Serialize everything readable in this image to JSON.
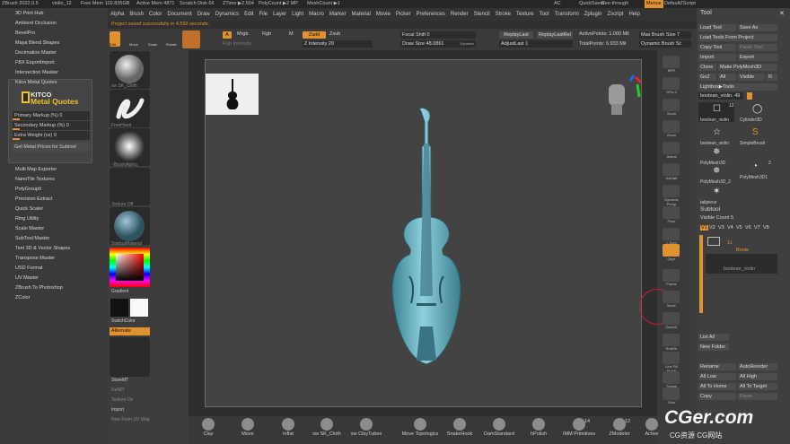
{
  "titlebar": {
    "app": "ZBrush 2022.0.5",
    "doc": "violin_12",
    "free_mem": "Free Mem 102.835GB",
    "active_mem": "Active Mem 4871",
    "scratch": "Scratch Disk 66",
    "ztime": "ZTime ▶2.504",
    "polycount": "PolyCount ▶2 MP",
    "meshcount": "MeshCount ▶1",
    "ac": "AC",
    "quicksave": "QuickSave",
    "seethrough": "See-through",
    "seethrough_val": "0",
    "menus": "Menus",
    "script": "DefaultZScript"
  },
  "menu": [
    "Alpha",
    "Brush",
    "Color",
    "Document",
    "Draw",
    "Dynamics",
    "Edit",
    "File",
    "Layer",
    "Light",
    "Macro",
    "Marker",
    "Material",
    "Movie",
    "Picker",
    "Preferences",
    "Render",
    "Stencil",
    "Stroke",
    "Texture",
    "Tool",
    "Transform",
    "Zplugin",
    "Zscript",
    "Help"
  ],
  "notification": "Project saved successfully in 4.592 seconds.",
  "left_plugins_top": [
    "3D Print Hub",
    "Ambient Occlusion",
    "BevelPro",
    "Maya Blend Shapes",
    "Decimation Master",
    "FBX ExportImport",
    "Intersection Masker",
    "Kitco Metal Quotes"
  ],
  "kitco": {
    "logo1": "KITCO",
    "logo2": "Metal Quotes",
    "primary": "Primary Markup (%) 0",
    "secondary": "Secondary Markup (%) 0",
    "extra": "Extra Weight (oz) 0",
    "button": "Get Metal Prices for Subtool"
  },
  "left_plugins_bottom": [
    "Multi Map Exporter",
    "NanoTile Textures",
    "PolyGroupIt",
    "Precision Extract",
    "Quick Scaler",
    "Ring Utility",
    "Scale Master",
    "SubTool Master",
    "Text 3D & Vector Shapes",
    "Transpose Master",
    "USD Format",
    "UV Master",
    "ZBrush To Photoshop",
    "ZColor"
  ],
  "shelf": {
    "brush": "sw SK_Cloth",
    "stroke": "FreeHand",
    "alpha": "~BrushAlpha",
    "texture": "Texture Off",
    "material": "StartupMaterial",
    "gradient": "Gradient",
    "switchcolor": "SwitchColor",
    "alternate": "Alternate",
    "store": "StoreMT",
    "delmt": "DelMT",
    "texon": "Texture On",
    "import": "Import",
    "newfromuv": "New From UV Map"
  },
  "topbar": {
    "edit": "Edit",
    "move": "Move",
    "scale": "Scale",
    "rotate": "Rotate",
    "a": "A",
    "mrgb": "Mrgb",
    "rgb": "Rgb",
    "m": "M",
    "zadd": "Zadd",
    "zsub": "Zsub",
    "rgb_intensity": "Rgb Intensity",
    "z_intensity": "Z Intensity 20",
    "focal_shift": "Focal Shift 0",
    "draw_size": "Draw Size 48.0861",
    "dynamic": "Dynamic",
    "replaylast": "ReplayLast",
    "replaylastrel": "ReplayLastRel",
    "adjustlast": "AdjustLast 1",
    "active_points": "ActivePoints: 1.000 Mil",
    "total_points": "TotalPoints: 6.933 Mil",
    "max_brush": "Max Brush Size 7",
    "dynamic_brush": "Dynamic Brush Sc"
  },
  "right_shelf": [
    "BPR",
    "SPix 3",
    "Scroll",
    "Zoom",
    "Actual",
    "AAHalf",
    "Dynamic Persp",
    "Floor",
    "L.Sym",
    "Qxyz",
    "Frame",
    "Move",
    "ZoomD",
    "RotaTe",
    "Line Fill PolyF",
    "Transp",
    "Solo"
  ],
  "tool_panel": {
    "title": "Tool",
    "load_tool": "Load Tool",
    "save_as": "Save As",
    "load_from_project": "Load Tools From Project",
    "copy_tool": "Copy Tool",
    "paste_tool": "Paste Tool",
    "import": "Import",
    "export": "Export",
    "clone": "Clone",
    "make_polymesh": "Make PolyMesh3D",
    "goz": "GoZ",
    "all": "All",
    "visible": "Visible",
    "r": "R",
    "lightbox": "Lightbox▶Tools",
    "current_tool": "boolean_violin. 49",
    "tools": [
      {
        "name": "boolean_violin",
        "count": "12"
      },
      {
        "name": "Cylinder3D",
        "count": ""
      },
      {
        "name": "SimpleBrush",
        "count": ""
      },
      {
        "name": "boolean_violin",
        "count": ""
      },
      {
        "name": "PolyMesh3D",
        "count": ""
      },
      {
        "name": "PolyMesh3D_2",
        "count": ""
      },
      {
        "name": "PolyMesh3D1",
        "count": "2"
      },
      {
        "name": "tailpiece",
        "count": ""
      }
    ],
    "subtool": "Subtool",
    "visible_count": "Visible Count 5",
    "tabs": [
      "V1",
      "V2",
      "V3",
      "V4",
      "V5",
      "V6",
      "V7",
      "V8"
    ],
    "folder_count": "11",
    "folder_label": "Boole",
    "subtool_item": "boolean_violin",
    "list_all": "List All",
    "new_folder": "New Folder",
    "rename": "Rename",
    "autoreorder": "AutoReorder",
    "all_low": "All Low",
    "all_high": "All High",
    "all_to_home": "All To Home",
    "all_to_target": "All To Target",
    "copy": "Copy",
    "paste": "Paste"
  },
  "bottom_brushes": [
    {
      "name": "Clay"
    },
    {
      "name": "Move"
    },
    {
      "name": "Inflat"
    },
    {
      "name": "sw SK_Cloth"
    },
    {
      "name": "sw ClayTubes"
    },
    {
      "name": "Move Topologics"
    },
    {
      "name": "SnakeHook"
    },
    {
      "name": "DamStandard"
    },
    {
      "name": "hPolish"
    },
    {
      "name": "IMM Primitives",
      "count": "14"
    },
    {
      "name": "ZModeler",
      "count": "12"
    },
    {
      "name": "Active"
    }
  ],
  "watermark": {
    "main": "CGer.com",
    "sub": "CG资源 CG网站"
  },
  "colors": {
    "accent": "#e0922f",
    "model": "#5fa9b8",
    "canvas": "#434343"
  }
}
